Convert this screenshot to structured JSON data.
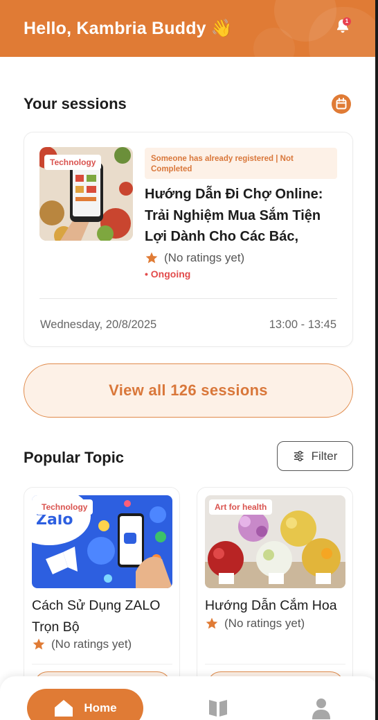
{
  "header": {
    "greeting": "Hello, Kambria Buddy",
    "wave_emoji": "👋",
    "notification_count": "1",
    "bell_icon": "bell-icon",
    "accent_color": "#e07b35"
  },
  "sessions": {
    "title": "Your sessions",
    "calendar_icon": "calendar-icon",
    "card": {
      "tag": "Technology",
      "status": "Someone has already registered | Not Completed",
      "title": "Hướng Dẫn Đi Chợ Online: Trải Nghiệm Mua Sắm Tiện Lợi Dành Cho Các Bác,",
      "rating": "(No ratings yet)",
      "state": "• Ongoing",
      "date": "Wednesday, 20/8/2025",
      "time": "13:00 - 13:45"
    },
    "view_all_label": "View all 126 sessions"
  },
  "popular": {
    "title": "Popular Topic",
    "filter_label": "Filter",
    "topics": [
      {
        "tag": "Technology",
        "name": "Cách Sử Dụng ZALO Trọn Bộ",
        "rating": "(No ratings yet)",
        "image_word": "Zalo"
      },
      {
        "tag": "Art for health",
        "name": "Hướng Dẫn Cắm Hoa",
        "rating": "(No ratings yet)"
      }
    ]
  },
  "nav": {
    "items": [
      {
        "label": "Home",
        "icon": "home-icon",
        "active": true
      },
      {
        "label": "",
        "icon": "book-icon",
        "active": false
      },
      {
        "label": "",
        "icon": "profile-icon",
        "active": false
      }
    ]
  }
}
